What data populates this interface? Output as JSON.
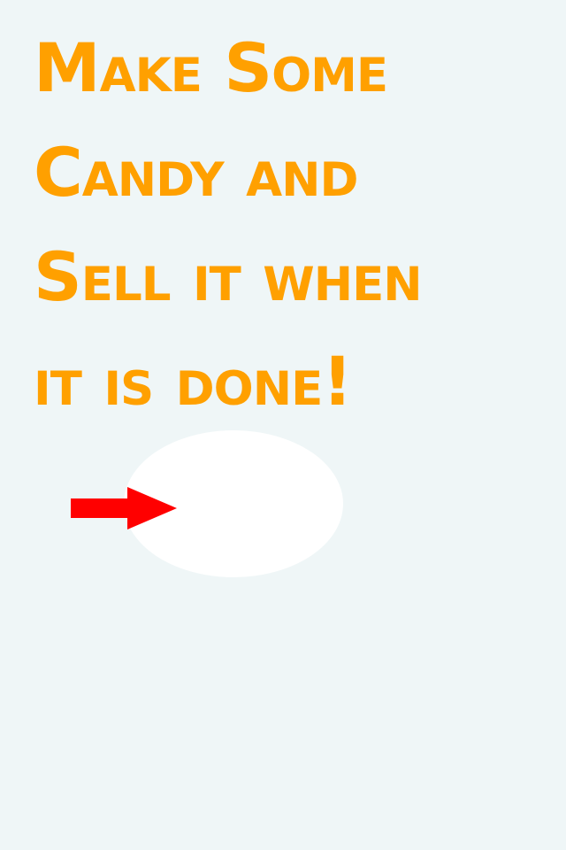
{
  "title": {
    "lines": [
      "Make Some",
      "Candy and",
      "Sell it when",
      "it is done!"
    ]
  },
  "colors": {
    "background": "#eff6f7",
    "title": "#ffa000",
    "candy_target": "#ffffff",
    "arrow": "#ff0000"
  },
  "icons": {
    "pointer": "arrow-right-icon"
  }
}
